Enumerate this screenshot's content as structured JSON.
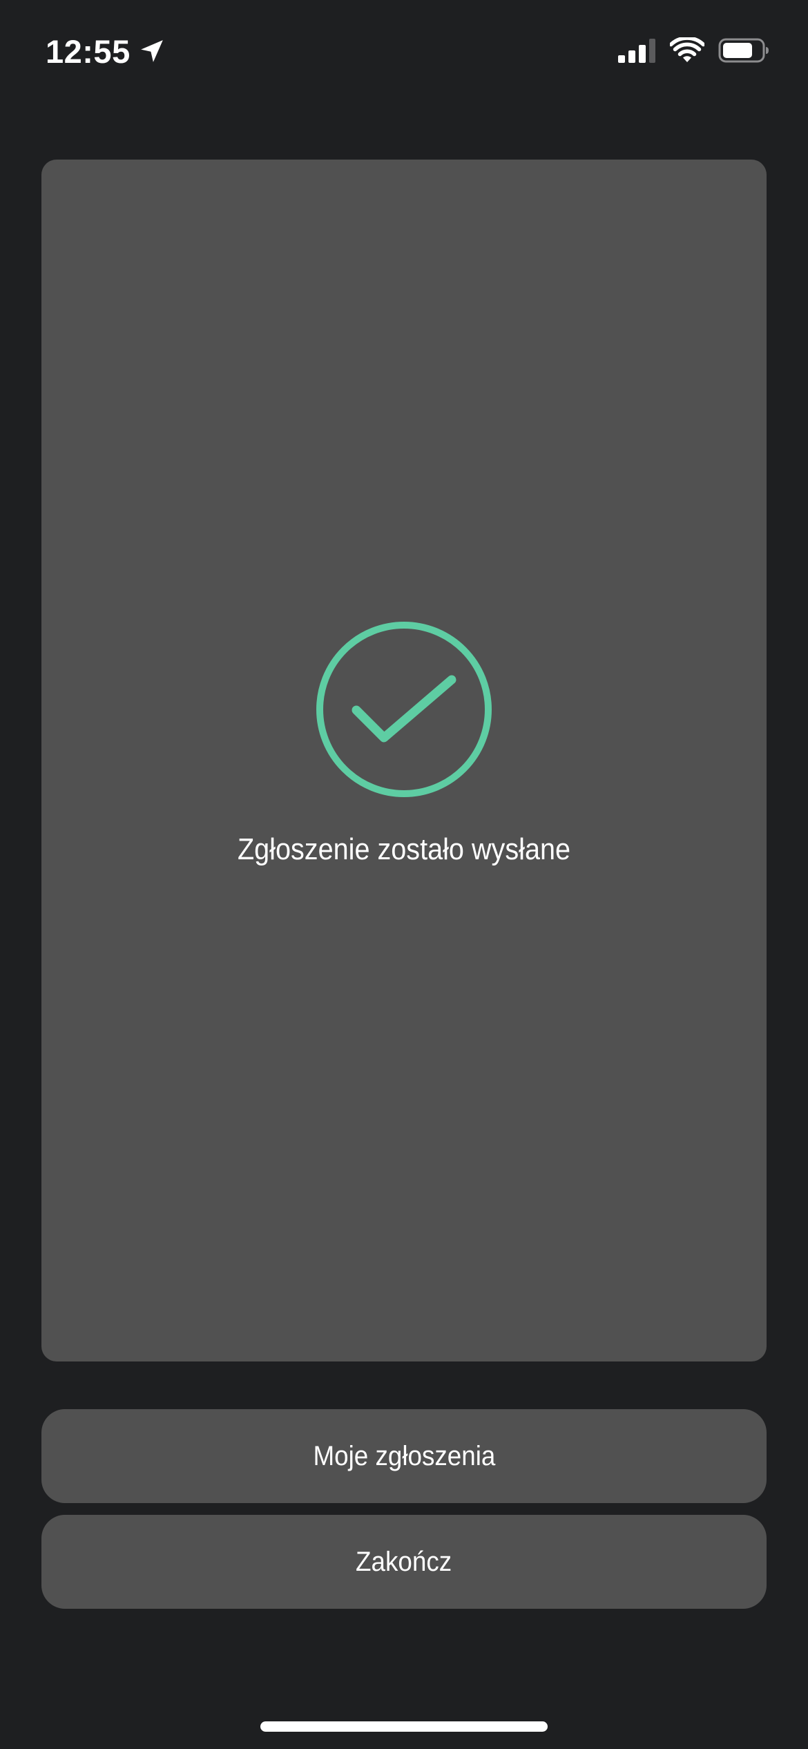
{
  "status_bar": {
    "time": "12:55",
    "icons": [
      "location-arrow-icon",
      "cellular-signal-icon",
      "wifi-icon",
      "battery-icon"
    ]
  },
  "success_card": {
    "icon": "check-circle-icon",
    "message": "Zgłoszenie zostało wysłane"
  },
  "actions": {
    "my_reports_label": "Moje zgłoszenia",
    "finish_label": "Zakończ"
  },
  "colors": {
    "background": "#1e1f21",
    "card": "#515151",
    "accent": "#5ecda3",
    "text": "#ffffff"
  }
}
